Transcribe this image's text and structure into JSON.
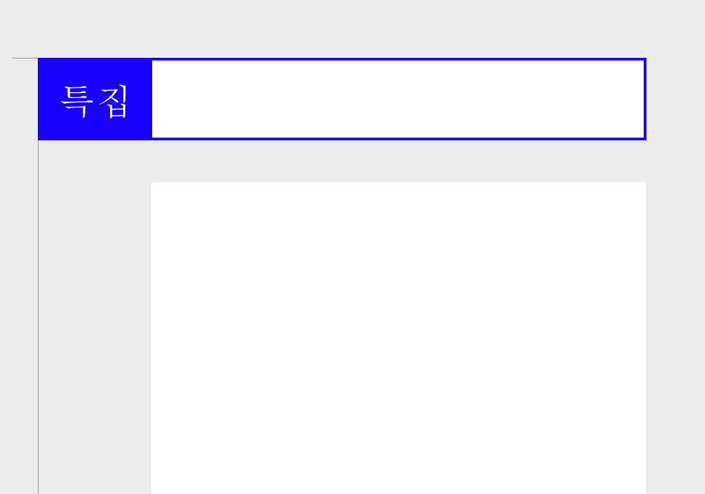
{
  "header": {
    "badge_label": "특집",
    "title": ""
  },
  "content": {
    "body": ""
  },
  "colors": {
    "accent": "#1800ff",
    "page_bg": "#ececec",
    "paper": "#ffffff"
  }
}
